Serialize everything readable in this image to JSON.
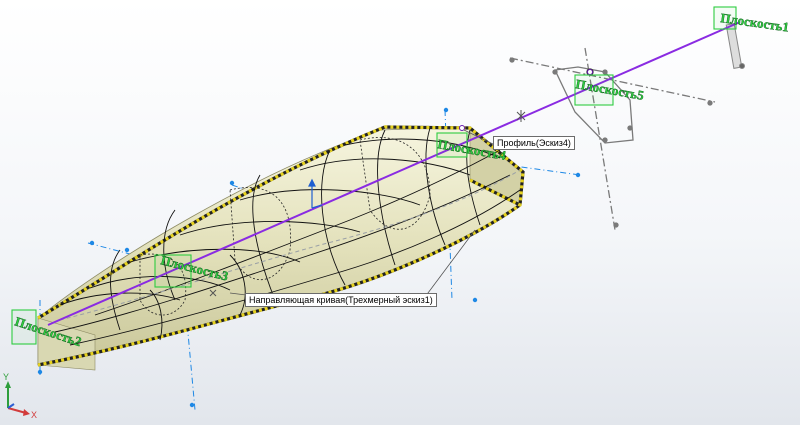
{
  "features": {
    "profile_callout": "Профиль(Эскиз4)",
    "guide_curve_callout": "Направляющая кривая(Трехмерный эскиз1)"
  },
  "planes": {
    "plane1": "Плоскость1",
    "plane2": "Плоскость2",
    "plane3": "Плоскость3",
    "plane4": "Плоскость4",
    "plane5": "Плоскость5"
  },
  "triad": {
    "x_label": "X",
    "y_label": "Y"
  },
  "colors": {
    "body_fill": "#e7e6c5",
    "sketch_line": "#111111",
    "path_line": "#8a2be2",
    "plane_green": "#2ecc40",
    "dim_line": "#1e88e5",
    "highlight": "#e6d21e"
  }
}
